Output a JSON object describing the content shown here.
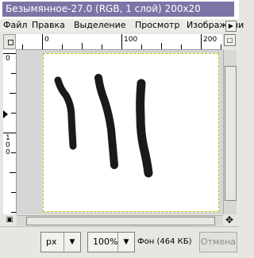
{
  "window": {
    "title": "Безымянное-27.0 (RGB, 1 слой) 200x20"
  },
  "menu": {
    "items": [
      {
        "label": "Файл"
      },
      {
        "label": "Правка"
      },
      {
        "label": "Выделение"
      },
      {
        "label": "Просмотр"
      },
      {
        "label": "Изображени"
      }
    ],
    "overflow_icon": "right-arrow-icon"
  },
  "ruler": {
    "h_labels": [
      "0",
      "100",
      "200"
    ],
    "v_labels": [
      "0",
      "100"
    ]
  },
  "canvas": {
    "background": "#ffffff",
    "stroke_color": "#1a1a1a",
    "strokes": 3
  },
  "statusbar": {
    "unit": "px",
    "zoom": "100%",
    "status": "Фон (464 КБ)",
    "cancel_label": "Отмена"
  },
  "colors": {
    "title_bg": "#7b75a6",
    "selection_border": "#c8c800"
  }
}
